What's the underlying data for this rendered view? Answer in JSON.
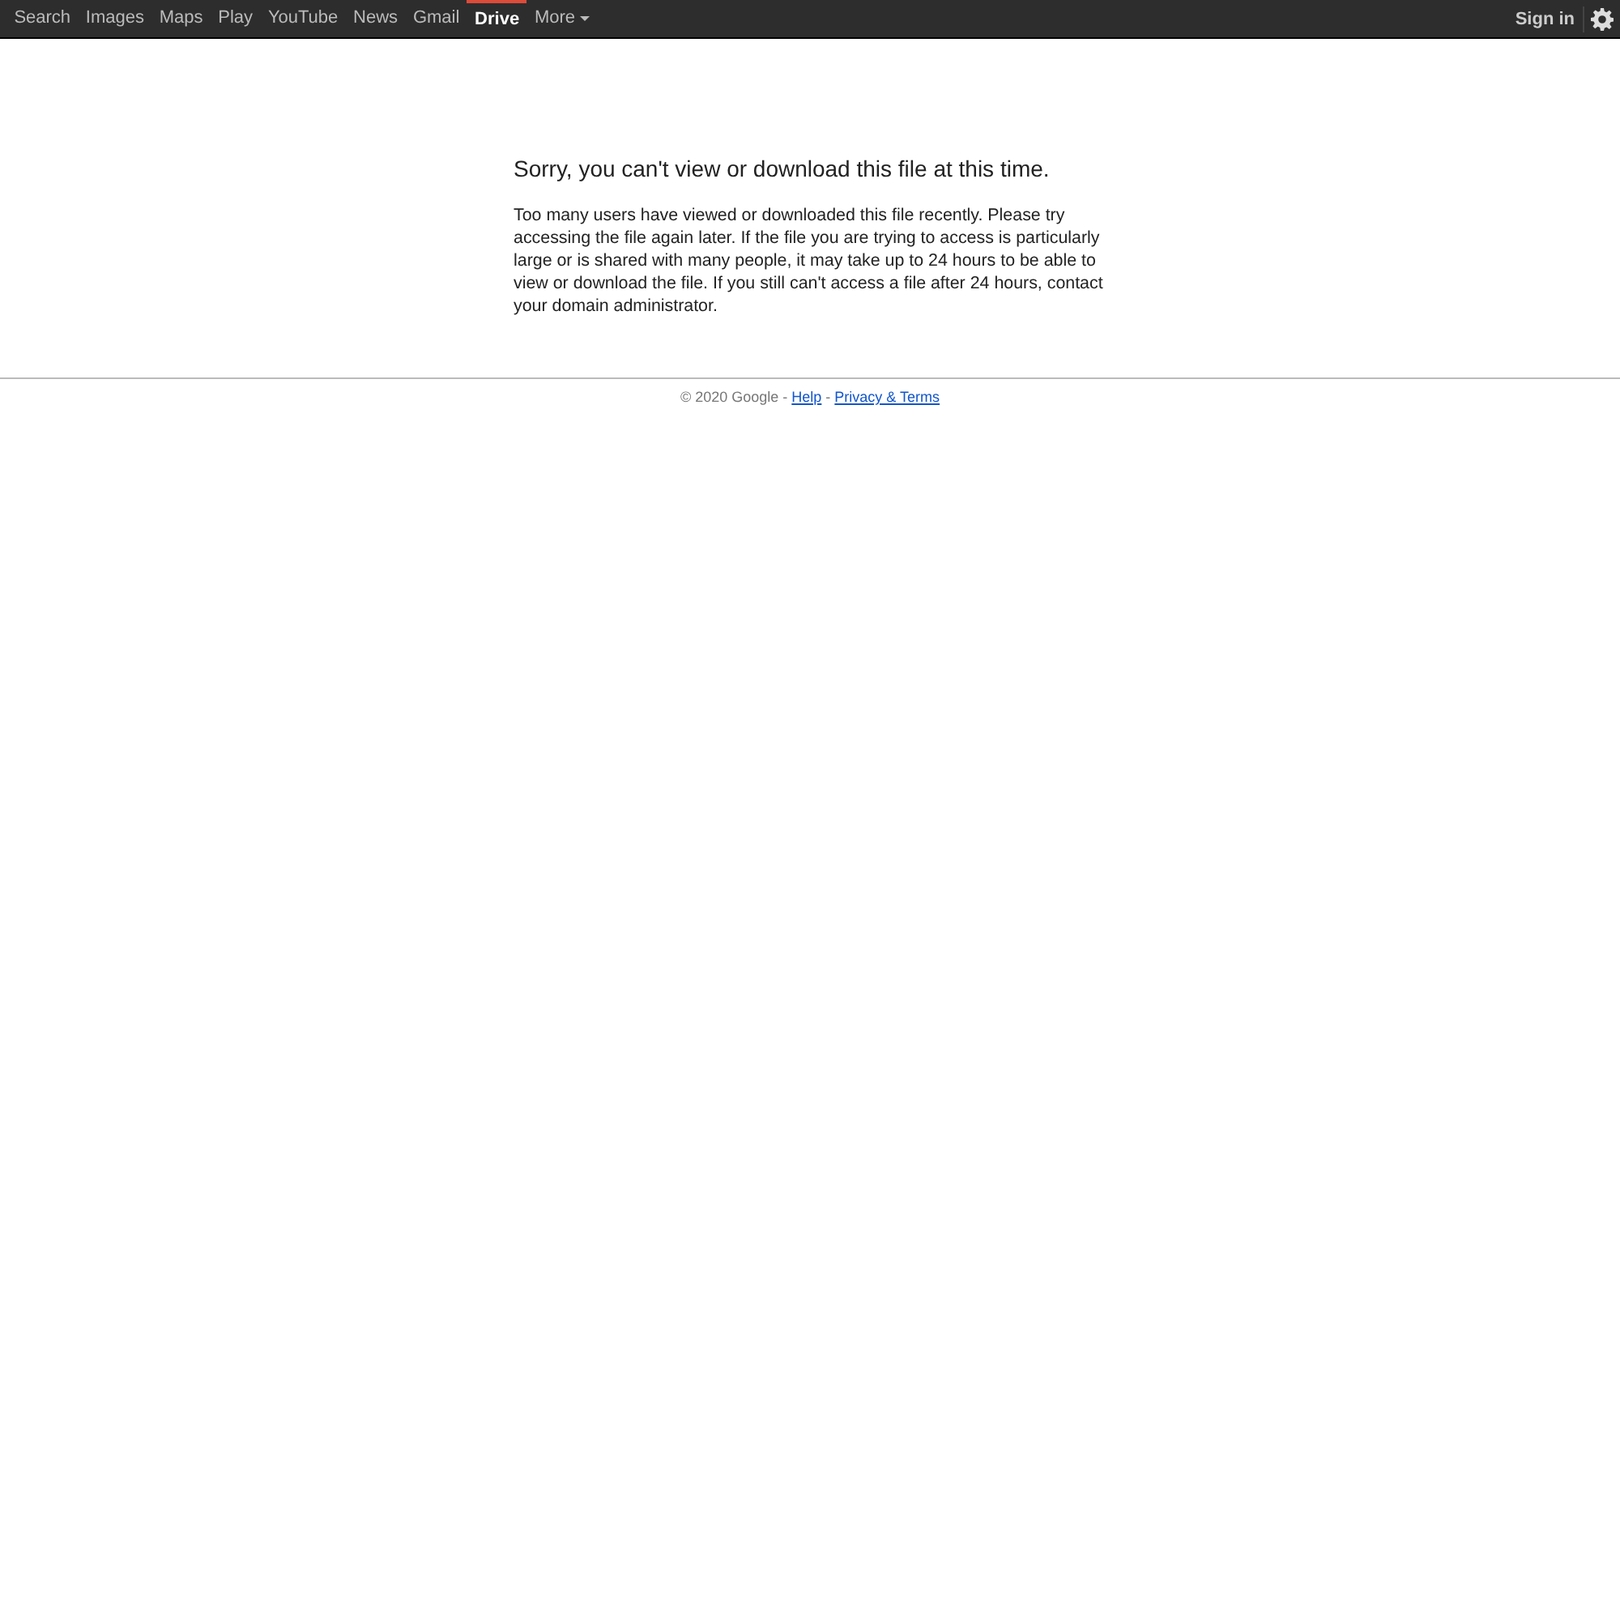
{
  "navbar": {
    "items": [
      {
        "label": "Search",
        "selected": false
      },
      {
        "label": "Images",
        "selected": false
      },
      {
        "label": "Maps",
        "selected": false
      },
      {
        "label": "Play",
        "selected": false
      },
      {
        "label": "YouTube",
        "selected": false
      },
      {
        "label": "News",
        "selected": false
      },
      {
        "label": "Gmail",
        "selected": false
      },
      {
        "label": "Drive",
        "selected": true
      },
      {
        "label": "More",
        "selected": false,
        "kind": "dropdown"
      }
    ],
    "sign_in": "Sign in"
  },
  "message": {
    "title": "Sorry, you can't view or download this file at this time.",
    "body": "Too many users have viewed or downloaded this file recently. Please try accessing the file again later. If the file you are trying to access is particularly large or is shared with many people, it may take up to 24 hours to be able to view or download the file. If you still can't access a file after 24 hours, contact your domain administrator."
  },
  "footer": {
    "copyright": "© 2020 Google",
    "separator": "-",
    "links": [
      "Help",
      "Privacy & Terms"
    ]
  }
}
